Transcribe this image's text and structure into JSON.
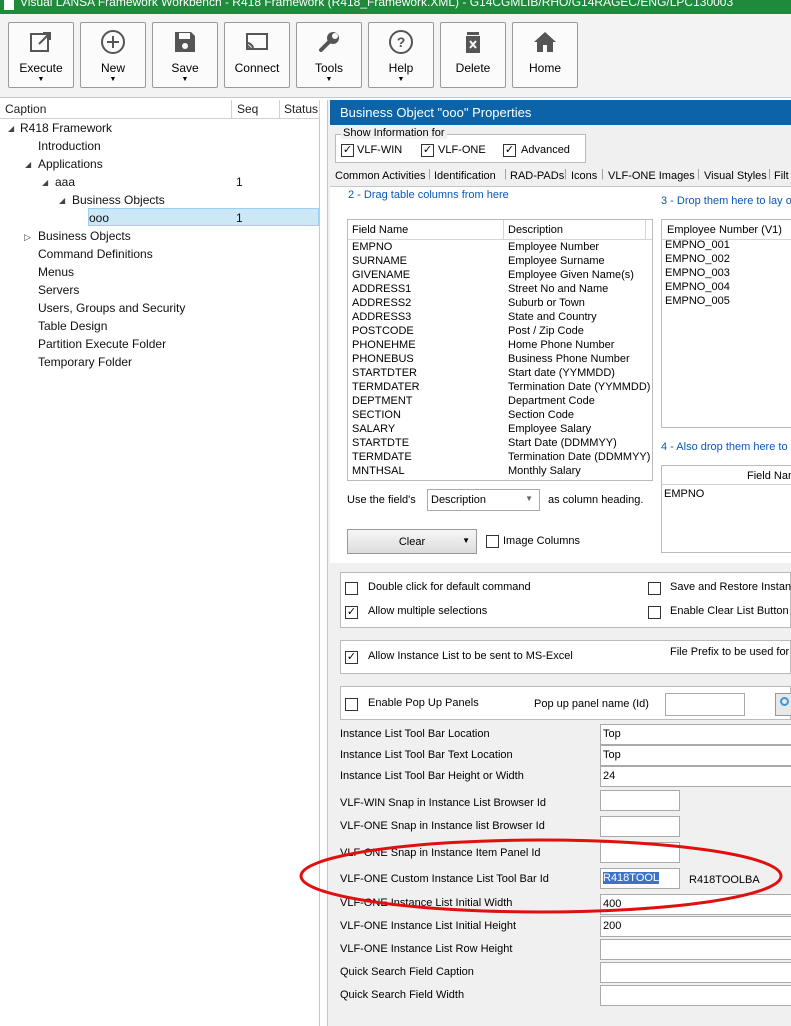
{
  "window": {
    "title": "Visual LANSA Framework Workbench - R418 Framework (R418_Framework.XML) - G14CGMLIB/RHO/G14RAGEC/ENG/LPC130003"
  },
  "toolbar": {
    "buttons": [
      {
        "label": "Execute",
        "icon": "execute-icon",
        "has_dropdown": true
      },
      {
        "label": "New",
        "icon": "plus-circle-icon",
        "has_dropdown": true
      },
      {
        "label": "Save",
        "icon": "floppy-disk-icon",
        "has_dropdown": true
      },
      {
        "label": "Connect",
        "icon": "cast-icon",
        "has_dropdown": false
      },
      {
        "label": "Tools",
        "icon": "wrench-icon",
        "has_dropdown": true
      },
      {
        "label": "Help",
        "icon": "question-circle-icon",
        "has_dropdown": true
      },
      {
        "label": "Delete",
        "icon": "trash-icon",
        "has_dropdown": false
      },
      {
        "label": "Home",
        "icon": "house-icon",
        "has_dropdown": false
      }
    ]
  },
  "tree": {
    "columns": [
      "Caption",
      "Seq",
      "Status"
    ],
    "nodes": [
      {
        "label": "R418 Framework",
        "seq": ""
      },
      {
        "label": "Introduction",
        "seq": ""
      },
      {
        "label": "Applications",
        "seq": ""
      },
      {
        "label": "aaa",
        "seq": "1"
      },
      {
        "label": "Business Objects",
        "seq": ""
      },
      {
        "label": "ooo",
        "seq": "1"
      },
      {
        "label": "Business Objects",
        "seq": ""
      },
      {
        "label": "Command Definitions",
        "seq": ""
      },
      {
        "label": "Menus",
        "seq": ""
      },
      {
        "label": "Servers",
        "seq": ""
      },
      {
        "label": "Users, Groups and Security",
        "seq": ""
      },
      {
        "label": "Table Design",
        "seq": ""
      },
      {
        "label": "Partition Execute Folder",
        "seq": ""
      },
      {
        "label": "Temporary Folder",
        "seq": ""
      }
    ]
  },
  "panel": {
    "title": "Business Object \"ooo\" Properties",
    "show_info": {
      "legend": "Show Information for",
      "options": [
        {
          "label": "VLF-WIN",
          "checked": true
        },
        {
          "label": "VLF-ONE",
          "checked": true
        },
        {
          "label": "Advanced",
          "checked": true
        }
      ]
    },
    "tabs": [
      "Common Activities",
      "Identification",
      "RAD-PADs",
      "Icons",
      "VLF-ONE Images",
      "Visual Styles",
      "Filt"
    ],
    "step2": "2 - Drag table columns from here",
    "step3": "3 - Drop them here to lay o",
    "step4": "4 - Also drop them here to d",
    "fields": {
      "headers": [
        "Field Name",
        "Description"
      ],
      "rows": [
        [
          "EMPNO",
          "Employee Number"
        ],
        [
          "SURNAME",
          "Employee Surname"
        ],
        [
          "GIVENAME",
          "Employee Given Name(s)"
        ],
        [
          "ADDRESS1",
          "Street No and Name"
        ],
        [
          "ADDRESS2",
          "Suburb or Town"
        ],
        [
          "ADDRESS3",
          "State and Country"
        ],
        [
          "POSTCODE",
          "Post / Zip Code"
        ],
        [
          "PHONEHME",
          "Home Phone Number"
        ],
        [
          "PHONEBUS",
          "Business Phone Number"
        ],
        [
          "STARTDTER",
          "Start date (YYMMDD)"
        ],
        [
          "TERMDATER",
          "Termination Date (YYMMDD)"
        ],
        [
          "DEPTMENT",
          "Department Code"
        ],
        [
          "SECTION",
          "Section Code"
        ],
        [
          "SALARY",
          "Employee Salary"
        ],
        [
          "STARTDTE",
          "Start Date (DDMMYY)"
        ],
        [
          "TERMDATE",
          "Termination Date (DDMMYY)"
        ],
        [
          "MNTHSAL",
          "Monthly Salary"
        ]
      ]
    },
    "preview": {
      "header": "Employee Number (V1)",
      "rows": [
        "EMPNO_001",
        "EMPNO_002",
        "EMPNO_003",
        "EMPNO_004",
        "EMPNO_005"
      ]
    },
    "drop2": {
      "header": "Field Nam",
      "rows": [
        "EMPNO"
      ]
    },
    "use_field_label": "Use the field's",
    "use_field_value": "Description",
    "use_field_suffix": "as column heading.",
    "clear_label": "Clear",
    "image_columns": "Image Columns",
    "options": {
      "double_click": "Double click for default command",
      "allow_multiple": "Allow multiple selections",
      "save_restore": "Save and Restore Instan",
      "enable_clear": "Enable Clear List Button",
      "allow_excel": "Allow Instance List to be sent to MS-Excel",
      "file_prefix": "File Prefix to be used for",
      "enable_popup": "Enable Pop Up Panels",
      "popup_name": "Pop up panel name (Id)"
    },
    "properties": [
      {
        "label": "Instance List Tool Bar Location",
        "value": "Top"
      },
      {
        "label": "Instance List Tool Bar Text Location",
        "value": "Top"
      },
      {
        "label": "Instance List Tool Bar Height or Width",
        "value": "24"
      },
      {
        "label": "VLF-WIN Snap in Instance List Browser Id",
        "value": ""
      },
      {
        "label": "VLF-ONE Snap in Instance list Browser Id",
        "value": ""
      },
      {
        "label": "VLF-ONE Snap in Instance Item Panel Id",
        "value": ""
      },
      {
        "label": "VLF-ONE Custom Instance List Tool Bar Id",
        "value": "R418TOOL"
      },
      {
        "label": "VLF-ONE Instance List Initial Width",
        "value": "400"
      },
      {
        "label": "VLF-ONE Instance List Initial Height",
        "value": "200"
      },
      {
        "label": "VLF-ONE Instance List Row Height",
        "value": ""
      },
      {
        "label": "Quick Search Field Caption",
        "value": ""
      },
      {
        "label": "Quick Search Field Width",
        "value": ""
      }
    ],
    "toolbar_note": "R418TOOLBA"
  },
  "annotation": {
    "color": "#e01010"
  },
  "colors": {
    "header": "#0d63a7",
    "title_bar": "#1f8a3c",
    "selection": "#cce8f7",
    "link": "#0a58b5"
  }
}
